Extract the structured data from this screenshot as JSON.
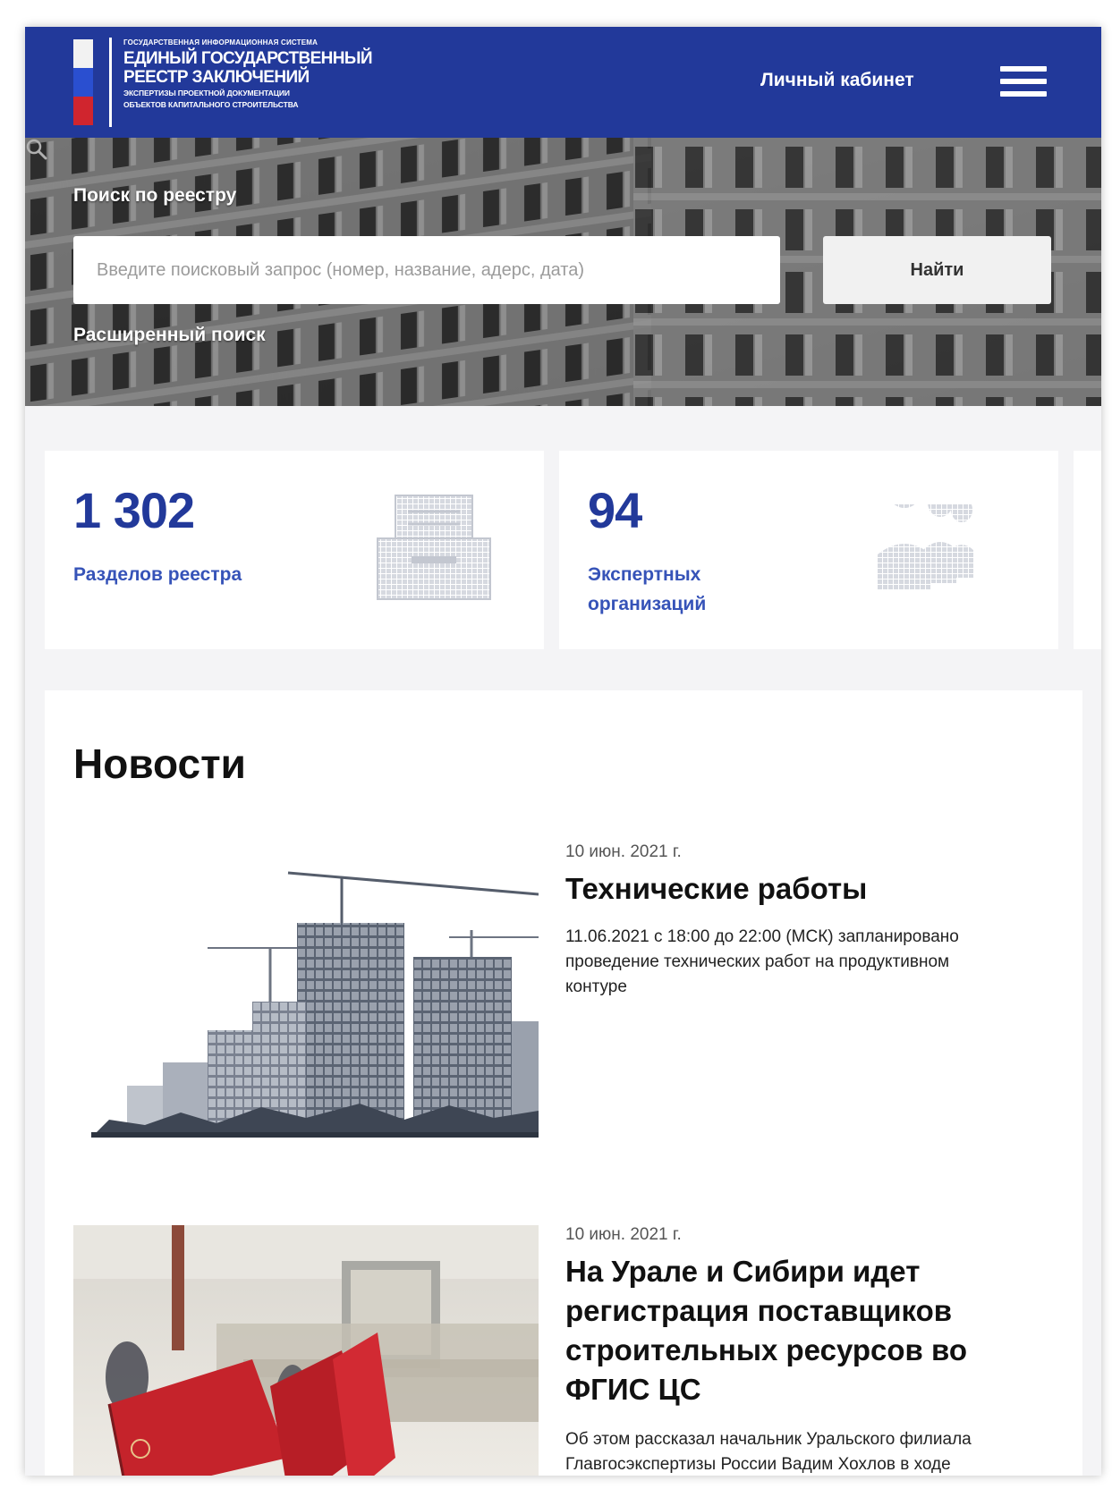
{
  "header": {
    "logo": {
      "line_small_top": "ГОСУДАРСТВЕННАЯ ИНФОРМАЦИОННАЯ СИСТЕМА",
      "line_big_1": "ЕДИНЫЙ ГОСУДАРСТВЕННЫЙ",
      "line_big_2": "РЕЕСТР ЗАКЛЮЧЕНИЙ",
      "line_small_1": "ЭКСПЕРТИЗЫ ПРОЕКТНОЙ ДОКУМЕНТАЦИИ",
      "line_small_2": "ОБЪЕКТОВ КАПИТАЛЬНОГО СТРОИТЕЛЬСТВА"
    },
    "cabinet_label": "Личный кабинет",
    "menu_icon": "hamburger-menu-icon",
    "brand_color": "#22399a"
  },
  "search": {
    "label": "Поиск по реестру",
    "placeholder": "Введите поисковый запрос (номер, название, адерс, дата)",
    "value": "",
    "button_label": "Найти",
    "advanced_label": "Расширенный поиск",
    "search_icon": "search-icon"
  },
  "stats": [
    {
      "value": "1 302",
      "label": "Разделов реестра",
      "icon": "registry-building-icon"
    },
    {
      "value": "94",
      "label": "Экспертных организаций",
      "icon": "people-group-icon"
    }
  ],
  "news": {
    "title": "Новости",
    "items": [
      {
        "date": "10 июн. 2021 г.",
        "title": "Технические работы",
        "body": "11.06.2021 с 18:00 до 22:00 (МСК) запланировано проведение технических работ на продуктивном контуре"
      },
      {
        "date": "10 июн. 2021 г.",
        "title": "На Урале и Сибири идет регистрация поставщиков строительных ресурсов во ФГИС ЦС",
        "body": "Об этом рассказал начальник Уральского филиала Главгосэкспертизы России Вадим Хохлов в ходе рабочей встречи с"
      }
    ]
  }
}
